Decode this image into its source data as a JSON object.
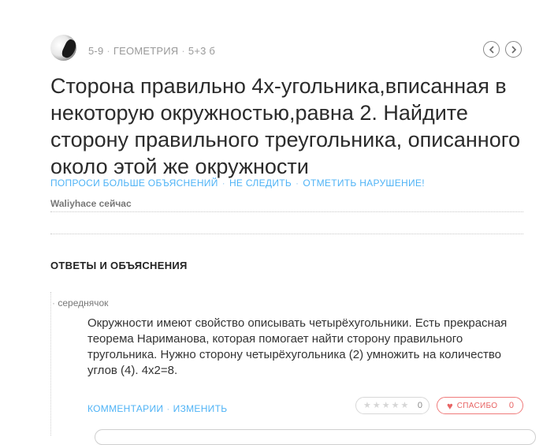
{
  "question": {
    "grade": "5-9",
    "subject": "ГЕОМЕТРИЯ",
    "points": "5+3 б",
    "text": "Сторона правильно 4х-угольника,вписанная в некоторую окружностью,равна 2. Найдите сторону правильного треугольника, описанного около этой же окружности",
    "actions": {
      "ask_more": "ПОПРОСИ БОЛЬШЕ ОБЪЯСНЕНИЙ",
      "unfollow": "НЕ СЛЕДИТЬ",
      "report": "ОТМЕТИТЬ НАРУШЕНИЕ!"
    },
    "author": "Waliyhace",
    "time": "сейчас"
  },
  "nav": {
    "prev_icon": "chevron-left-icon",
    "next_icon": "chevron-right-icon"
  },
  "answers": {
    "title": "ОТВЕТЫ И ОБЪЯСНЕНИЯ",
    "items": [
      {
        "rank": "середнячок",
        "text": "Окружности имеют свойство описывать четырёхугольники. Есть прекрасная теорема Нариманова, которая помогает найти сторону правильного тругольника. Нужно сторону четырёхугольника (2) умножить на количество углов (4). 4х2=8.",
        "comments_label": "КОММЕНТАРИИ",
        "edit_label": "ИЗМЕНИТЬ",
        "rating_count": "0",
        "thanks_label": "СПАСИБО",
        "thanks_count": "0"
      }
    ]
  },
  "colors": {
    "link": "#4fb3f6",
    "thanks": "#e86464"
  }
}
